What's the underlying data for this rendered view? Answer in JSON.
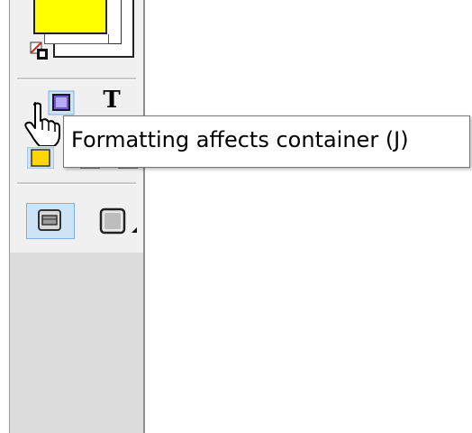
{
  "toolbar": {
    "fill_color": "#ffff00",
    "stroke_color": "#000000",
    "selected_highlight": "#cfe3f7",
    "buttons": [
      {
        "name": "formatting-affects-container-button",
        "icon": "container-icon",
        "selected": true
      },
      {
        "name": "formatting-affects-text-button",
        "icon": "text-T-icon",
        "label": "T",
        "selected": false
      },
      {
        "name": "apply-color-button",
        "icon": "yellow-swatch-icon",
        "selected": true
      },
      {
        "name": "normal-view-button",
        "icon": "normal-view-icon",
        "selected": true
      },
      {
        "name": "preview-mode-button",
        "icon": "preview-mode-icon",
        "selected": false
      }
    ]
  },
  "tooltip": {
    "text": "Formatting affects container (J)"
  },
  "cursor": {
    "icon": "hand-pointer-icon"
  }
}
